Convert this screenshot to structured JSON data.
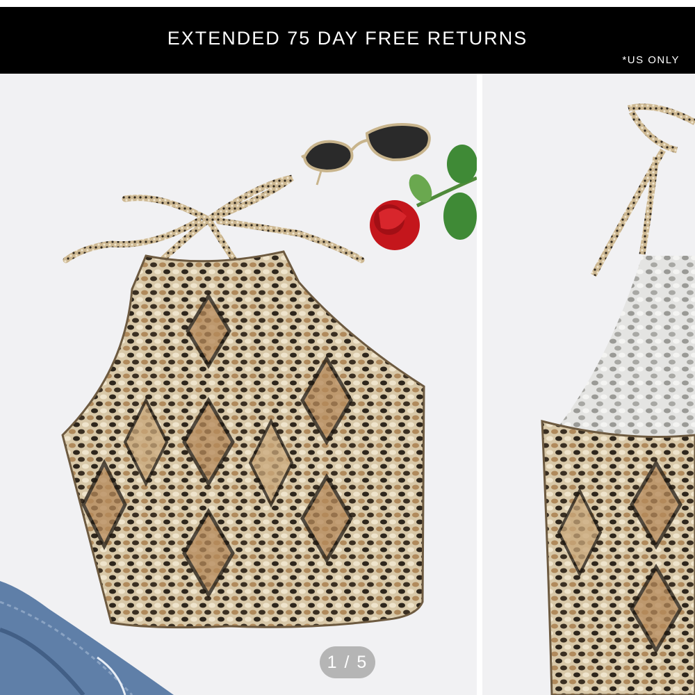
{
  "banner": {
    "title": "EXTENDED 75 DAY FREE RETURNS",
    "note": "*US ONLY"
  },
  "gallery": {
    "pager": "1 / 5",
    "current_slide": 1,
    "total_slides": 5
  },
  "colors": {
    "banner_bg": "#000000",
    "banner_text": "#ffffff",
    "slide_bg": "#f1f1f3",
    "pager_bg": "#a0a0a0"
  },
  "icons": {
    "slide_1": "snakeskin-halter-top-front-photo",
    "slide_2": "snakeskin-halter-top-back-photo"
  }
}
